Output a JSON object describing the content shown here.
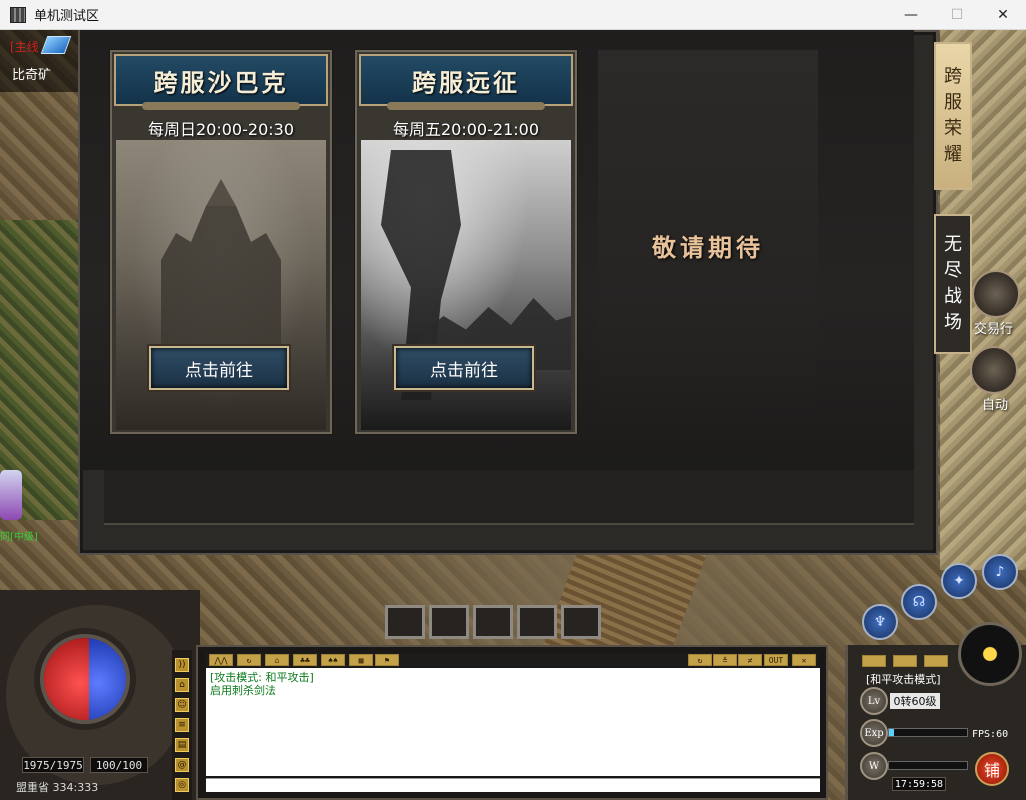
{
  "window": {
    "title": "单机测试区",
    "minimize": "—",
    "maximize": "☐",
    "close": "✕"
  },
  "hud_top_left": {
    "server_tag": "[主线",
    "location_name": "比奇矿"
  },
  "player": {
    "label": "同[中级]"
  },
  "modal": {
    "cards": [
      {
        "title": "跨服沙巴克",
        "schedule": "每周日20:00-20:30",
        "button": "点击前往"
      },
      {
        "title": "跨服远征",
        "schedule": "每周五20:00-21:00",
        "button": "点击前往"
      }
    ],
    "coming_soon": "敬请期待"
  },
  "side_tabs": [
    {
      "label": "跨服荣耀",
      "active": true
    },
    {
      "label": "无尽战场",
      "active": false
    }
  ],
  "round_buttons": {
    "trade": "交易行",
    "auto": "自动"
  },
  "hud_bottom": {
    "hp": "1975/1975",
    "mp": "100/100",
    "map_coords": "盟重省 334:333",
    "chat_lines": [
      "[攻击模式: 和平攻击]",
      "启用刺杀剑法"
    ],
    "chat_out_label": "OUT",
    "attack_mode": "[和平攻击模式]",
    "lv_label": "Lv",
    "level": "0转60级",
    "exp_label": "Exp",
    "exp_fraction": 0.06,
    "wt_label": "W",
    "wt_fraction": 0.0,
    "fps": "FPS:60",
    "clock": "17:59:58",
    "shop": "铺"
  }
}
